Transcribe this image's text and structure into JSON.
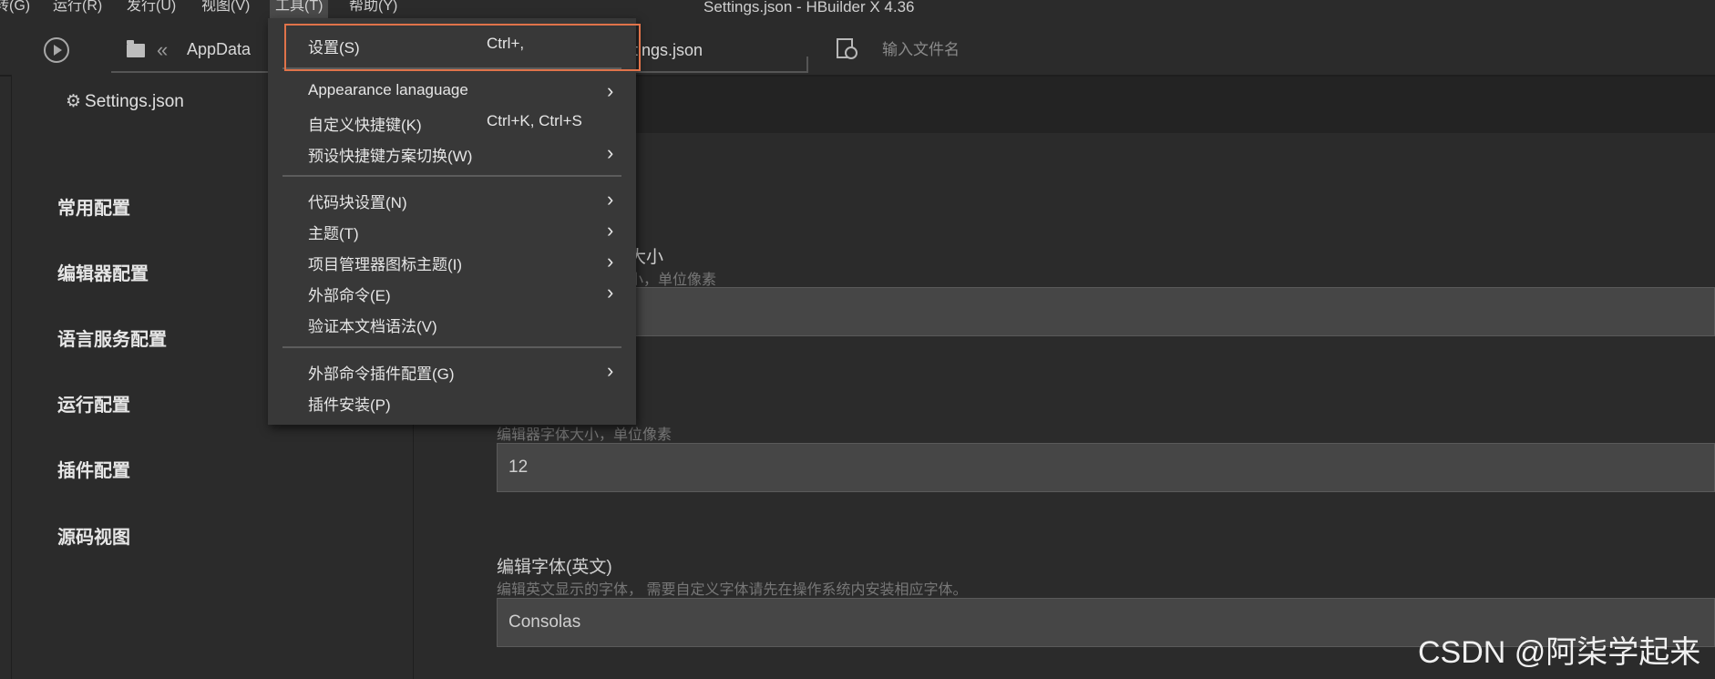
{
  "menubar": {
    "items": [
      "转(G)",
      "运行(R)",
      "发行(U)",
      "视图(V)",
      "工具(T)",
      "帮助(Y)"
    ],
    "window_title": "Settings.json - HBuilder X 4.36"
  },
  "toolbar": {
    "breadcrumb": "AppData",
    "breadcrumb_tail": "ttings.json",
    "search_placeholder": "输入文件名"
  },
  "sidebar": {
    "file_title": "Settings.json",
    "items": [
      "常用配置",
      "编辑器配置",
      "语言服务配置",
      "运行配置",
      "插件配置",
      "源码视图"
    ]
  },
  "main": {
    "field1_label_fragment": "大小",
    "field1_desc_fragment": "小，单位像素",
    "field1_value": "",
    "field2_desc": "编辑器字体大小，单位像素",
    "field2_value": "12",
    "field3_label": "编辑字体(英文)",
    "field3_desc": "编辑英文显示的字体， 需要自定义字体请先在操作系统内安装相应字体。",
    "field3_value": "Consolas"
  },
  "tools_menu": {
    "items": [
      {
        "label": "设置(S)",
        "shortcut": "Ctrl+,",
        "submenu": false
      },
      {
        "label": "Appearance lanaguage",
        "shortcut": "",
        "submenu": true
      },
      {
        "label": "自定义快捷键(K)",
        "shortcut": "Ctrl+K, Ctrl+S",
        "submenu": false
      },
      {
        "label": "预设快捷键方案切换(W)",
        "shortcut": "",
        "submenu": true
      },
      {
        "label": "代码块设置(N)",
        "shortcut": "",
        "submenu": true
      },
      {
        "label": "主题(T)",
        "shortcut": "",
        "submenu": true
      },
      {
        "label": "项目管理器图标主题(I)",
        "shortcut": "",
        "submenu": true
      },
      {
        "label": "外部命令(E)",
        "shortcut": "",
        "submenu": true
      },
      {
        "label": "验证本文档语法(V)",
        "shortcut": "",
        "submenu": false
      },
      {
        "label": "外部命令插件配置(G)",
        "shortcut": "",
        "submenu": true
      },
      {
        "label": "插件安装(P)",
        "shortcut": "",
        "submenu": false
      }
    ],
    "arrow_glyph": "›"
  },
  "watermark": "CSDN @阿柒学起来",
  "colors": {
    "background": "#2b2b2b",
    "menu": "#383838",
    "highlight": "#e0734a"
  }
}
